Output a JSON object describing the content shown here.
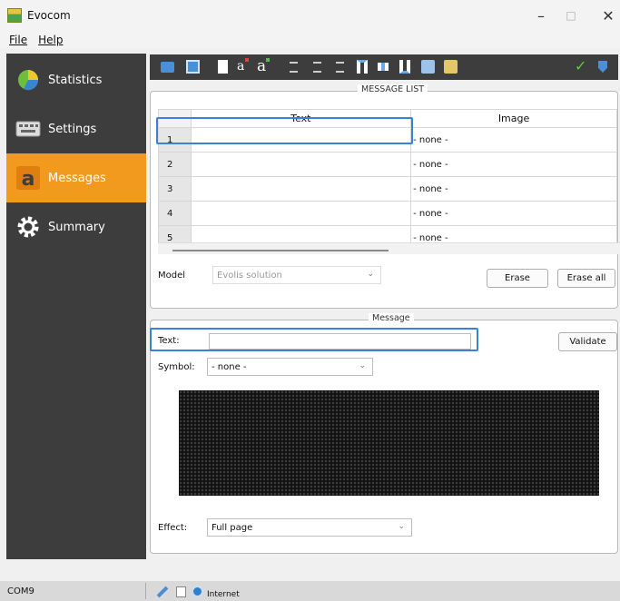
{
  "window": {
    "title": "Evocom"
  },
  "menu": {
    "file": "File",
    "help": "Help"
  },
  "sidebar": {
    "items": [
      {
        "label": "Statistics",
        "icon": "pie-chart-icon"
      },
      {
        "label": "Settings",
        "icon": "keyboard-icon"
      },
      {
        "label": "Messages",
        "icon": "letter-a-icon",
        "active": true
      },
      {
        "label": "Summary",
        "icon": "gear-icon"
      }
    ]
  },
  "toolbar": {
    "icons": [
      "open-folder-icon",
      "save-icon",
      "page-icon",
      "font-small-icon",
      "font-large-icon",
      "align-left-icon",
      "align-center-icon",
      "align-right-icon",
      "valign-top-icon",
      "valign-middle-icon",
      "valign-bottom-icon",
      "image-add-icon",
      "image-edit-icon",
      "check-icon",
      "download-icon"
    ],
    "font_small": "a",
    "font_large": "a"
  },
  "message_list": {
    "legend": "MESSAGE LIST",
    "columns": [
      "",
      "Text",
      "Image"
    ],
    "rows": [
      {
        "num": "1",
        "text": "",
        "image": "- none -"
      },
      {
        "num": "2",
        "text": "",
        "image": "- none -"
      },
      {
        "num": "3",
        "text": "",
        "image": "- none -"
      },
      {
        "num": "4",
        "text": "",
        "image": "- none -"
      },
      {
        "num": "5",
        "text": "",
        "image": "- none -"
      }
    ],
    "model_label": "Model",
    "model_value": "Evolis solution",
    "erase_label": "Erase",
    "erase_all_label": "Erase all"
  },
  "message": {
    "legend": "Message",
    "text_label": "Text:",
    "text_value": "",
    "validate_label": "Validate",
    "symbol_label": "Symbol:",
    "symbol_value": "- none -",
    "effect_label": "Effect:",
    "effect_value": "Full page"
  },
  "status": {
    "port": "COM9",
    "internet": "Internet"
  },
  "colors": {
    "accent": "#f19a1e",
    "sidebar": "#3d3d3d",
    "selection": "#3a82d6"
  }
}
